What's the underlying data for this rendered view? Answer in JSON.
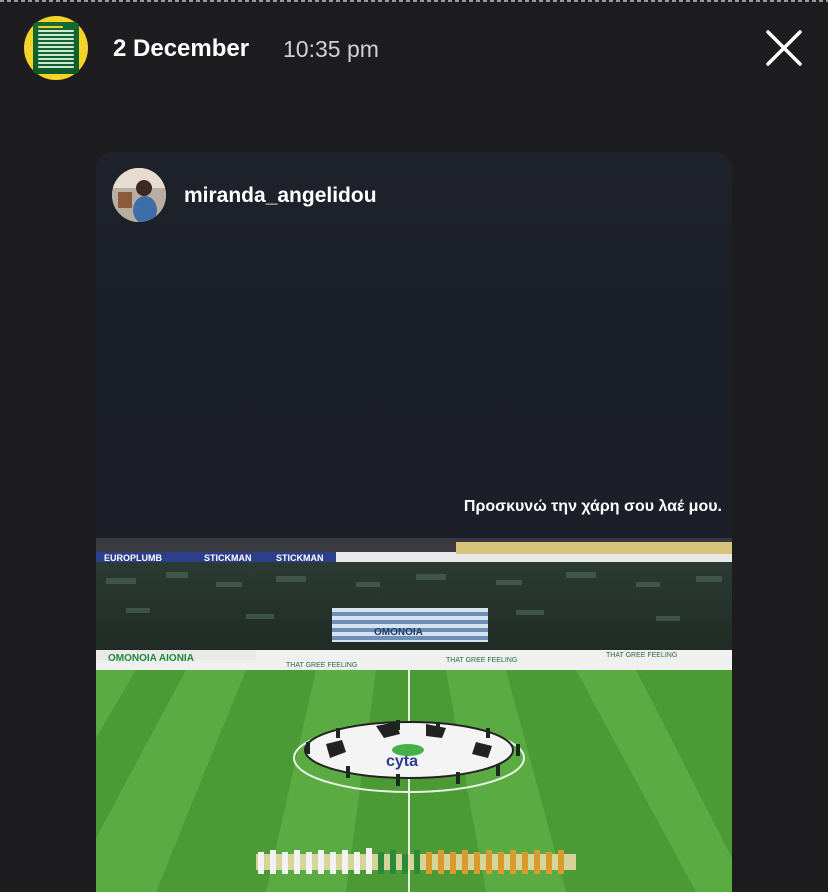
{
  "story": {
    "date": "2 December",
    "time": "10:35 pm",
    "close_icon": "close-icon"
  },
  "post": {
    "username": "miranda_angelidou",
    "caption": "Προσκυνώ την χάρη σου λαέ μου."
  },
  "photo": {
    "banners": [
      "EUROPLUMB",
      "STICKMAN",
      "STICKMAN"
    ],
    "flag_text": "OMONOIA",
    "ad_board": "OMONOIA AIONIA",
    "ad_text": "THAT GREE FEELING",
    "centre_logo": "cyta"
  },
  "colors": {
    "background": "#1d1d1f",
    "pitch": "#4c9a36",
    "avatar_ring": "#f4d329"
  }
}
